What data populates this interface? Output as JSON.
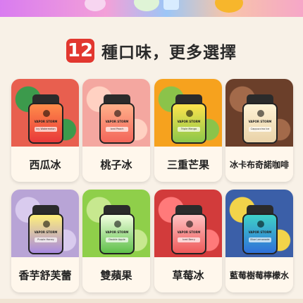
{
  "headline": {
    "count": "12",
    "text": "種口味，更多選擇"
  },
  "device_brand": "VAPOR STORM",
  "products": [
    {
      "name": "西瓜冰",
      "flavor_tag": "Icy Watermelon",
      "photo_color": "#e85f4f",
      "accent": "#3c9a4c",
      "body_top": "#ff8c4a",
      "body_bottom": "#e8393a"
    },
    {
      "name": "桃子冰",
      "flavor_tag": "Iced Peach",
      "photo_color": "#f4a7a0",
      "accent": "#ffd1c2",
      "body_top": "#ffb08a",
      "body_bottom": "#f3665a"
    },
    {
      "name": "三重芒果",
      "flavor_tag": "Triple Mango",
      "photo_color": "#f6a21e",
      "accent": "#8bc34a",
      "body_top": "#ffe44d",
      "body_bottom": "#8bc74a"
    },
    {
      "name": "冰卡布奇諾咖啡",
      "flavor_tag": "Cappuccino Ice",
      "photo_color": "#6b3f2a",
      "accent": "#a36a4a",
      "body_top": "#fff3d6",
      "body_bottom": "#e9d2a8"
    },
    {
      "name": "香芋舒芙蕾",
      "flavor_tag": "Purple Honey",
      "photo_color": "#b8a4d6",
      "accent": "#d9cbee",
      "body_top": "#fff07a",
      "body_bottom": "#a889e0"
    },
    {
      "name": "雙蘋果",
      "flavor_tag": "Double Apple",
      "photo_color": "#8fcf4a",
      "accent": "#c7e88f",
      "body_top": "#f2ffe0",
      "body_bottom": "#5fc04a"
    },
    {
      "name": "草莓冰",
      "flavor_tag": "Iced Berry",
      "photo_color": "#d23b3b",
      "accent": "#ff7a7a",
      "body_top": "#ffc2c2",
      "body_bottom": "#ee5a5a"
    },
    {
      "name": "藍莓樹莓檸檬水",
      "flavor_tag": "Blue Lemonade",
      "photo_color": "#3b5fa8",
      "accent": "#f2d34a",
      "body_top": "#3fd2c8",
      "body_bottom": "#2f6fd8"
    }
  ]
}
